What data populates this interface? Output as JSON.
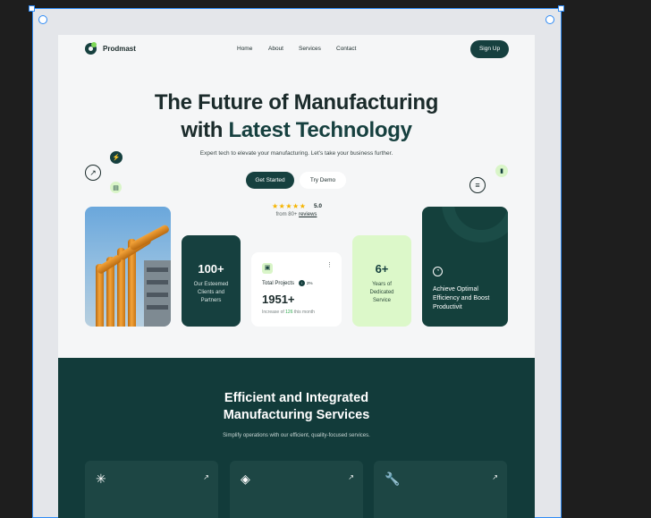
{
  "nav": {
    "brand": "Prodmast",
    "links": [
      "Home",
      "About",
      "Services",
      "Contact"
    ],
    "signup": "Sign Up"
  },
  "hero": {
    "title_line1": "The Future of Manufacturing",
    "title_line2_plain": "with ",
    "title_line2_accent": "Latest Technology",
    "subtitle": "Expert tech to elevate your manufacturing. Let's take your business further.",
    "primary_button": "Get Started",
    "secondary_button": "Try Demo",
    "stars": "★★★★★",
    "rating": "5.0",
    "reviews_prefix": "from 80+ ",
    "reviews_link": "reviews"
  },
  "stats": {
    "clients_value": "100+",
    "clients_label": "Our Esteemed Clients and Partners",
    "projects_title": "Total Projects",
    "projects_change": "2%",
    "projects_value": "1951+",
    "projects_note_prefix": "Increase of ",
    "projects_note_value": "126",
    "projects_note_suffix": " this month",
    "years_value": "6+",
    "years_label": "Years of Dedicated Service",
    "efficiency_text": "Achieve Optimal Efficiency and Boost Productivit"
  },
  "services": {
    "title_line1": "Efficient and Integrated",
    "title_line2": "Manufacturing Services",
    "subtitle": "Simplify operations with our efficient, quality-focused services.",
    "cards": [
      {
        "icon": "sparkle-icon",
        "glyph": "✳"
      },
      {
        "icon": "layers-icon",
        "glyph": "◈"
      },
      {
        "icon": "wrench-icon",
        "glyph": "🔧"
      }
    ],
    "arrow_glyph": "↗"
  },
  "icons": {
    "arrow": "↗",
    "dark_badge": "⚡",
    "doc": "▤",
    "bars": "▮",
    "menu": "≡",
    "kebab": "⋮",
    "project": "▣",
    "gauge": "◔"
  },
  "colors": {
    "primary": "#16403f",
    "accent_green": "#dcf8c9",
    "section_bg": "#123b3a",
    "selection": "#2f8bf5"
  }
}
